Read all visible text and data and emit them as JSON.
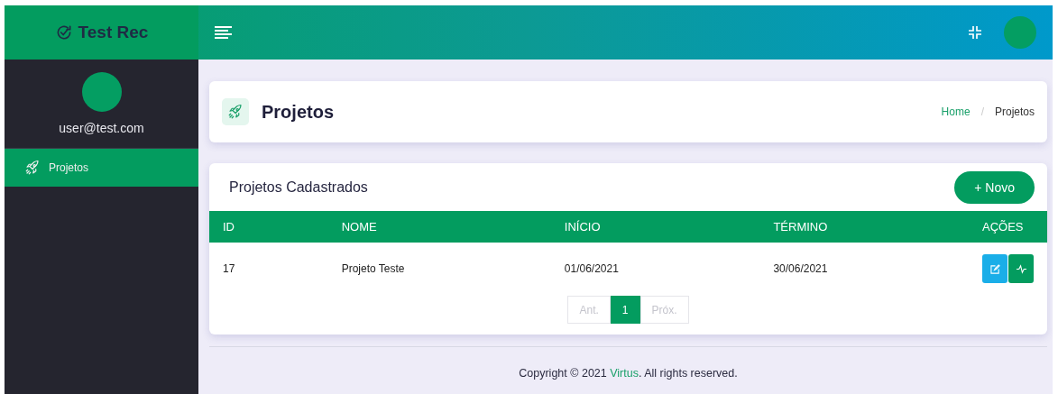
{
  "brand": {
    "title": "Test Rec"
  },
  "sidebar": {
    "user": "user@test.com",
    "items": [
      {
        "label": "Projetos",
        "selected": true
      }
    ]
  },
  "page_header": {
    "title": "Projetos",
    "breadcrumb": [
      {
        "label": "Home",
        "selected": false
      },
      {
        "label": "Projetos",
        "selected": true
      }
    ],
    "separator": "/"
  },
  "card": {
    "title": "Projetos Cadastrados",
    "new_button": "+ Novo",
    "table": {
      "columns": [
        "ID",
        "NOME",
        "INÍCIO",
        "TÉRMINO",
        "AÇÕES"
      ],
      "rows": [
        {
          "cells": [
            "17",
            "Projeto Teste",
            "01/06/2021",
            "30/06/2021"
          ]
        }
      ]
    },
    "pagination": [
      {
        "label": "Ant.",
        "disabled": true,
        "selected": false
      },
      {
        "label": "1",
        "disabled": false,
        "selected": true
      },
      {
        "label": "Próx.",
        "disabled": true,
        "selected": false
      }
    ]
  },
  "footer": {
    "before": "Copyright © 2021 ",
    "link": "Virtus",
    "after": ". All rights reserved."
  }
}
